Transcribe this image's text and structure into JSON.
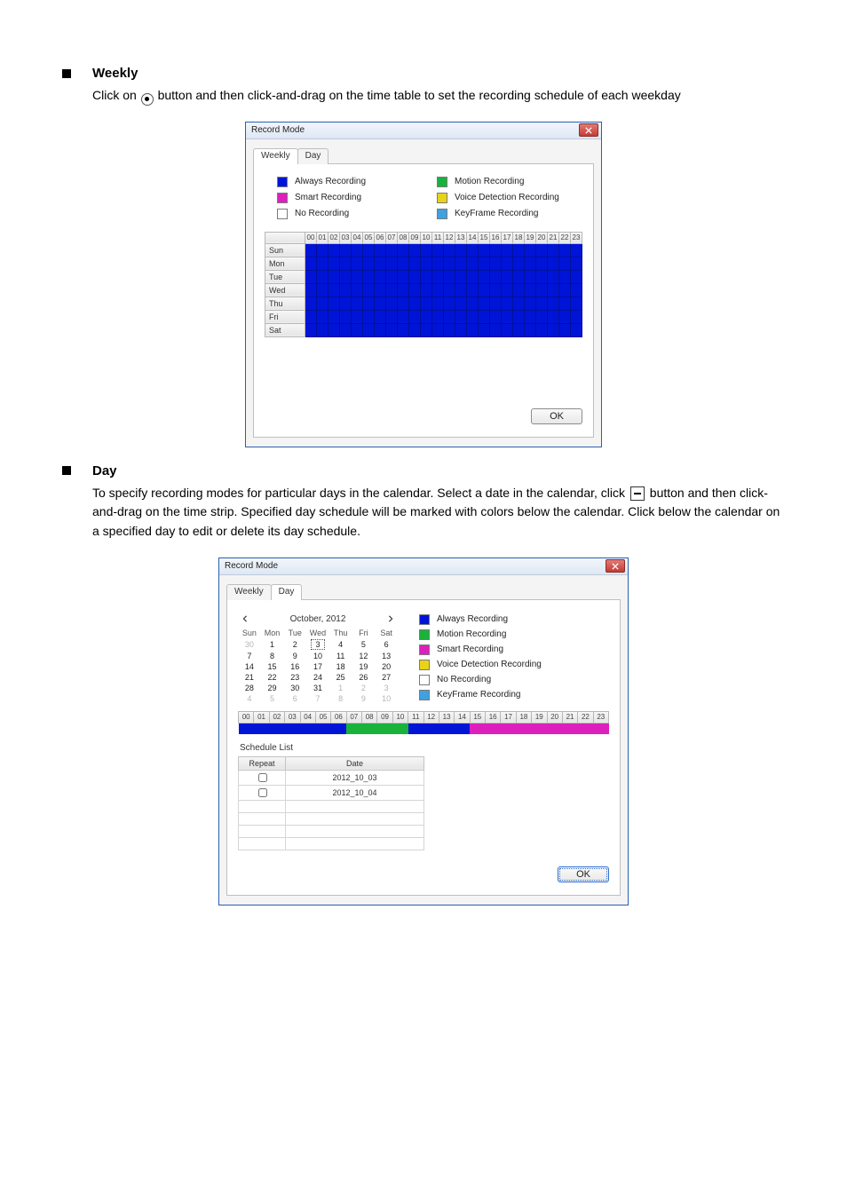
{
  "sections": {
    "weekly": {
      "title": "Weekly",
      "text": "Click on  button and then click-and-drag on the time table to set the recording schedule of each weekday"
    },
    "day": {
      "title": "Day",
      "text_a": "To specify recording modes for particular days in the calendar. Select a date in the calendar, click ",
      "text_b": " button and then click-and-drag on the time strip. Specified day schedule will be marked with colors below the calendar. Click below the calendar on a specified day to edit or delete its day schedule."
    }
  },
  "dialog_weekly": {
    "title": "Record Mode",
    "tabs": {
      "weekly": "Weekly",
      "day": "Day"
    },
    "legend": {
      "always": "Always Recording",
      "motion": "Motion Recording",
      "smart": "Smart Recording",
      "voice": "Voice Detection Recording",
      "none": "No Recording",
      "keyframe": "KeyFrame Recording"
    },
    "colors": {
      "always": "#0014d8",
      "motion": "#19b23b",
      "smart": "#dd1fbe",
      "voice": "#e8d317",
      "none": "#ffffff",
      "keyframe": "#3fa1e0"
    },
    "hours": [
      "00",
      "01",
      "02",
      "03",
      "04",
      "05",
      "06",
      "07",
      "08",
      "09",
      "10",
      "11",
      "12",
      "13",
      "14",
      "15",
      "16",
      "17",
      "18",
      "19",
      "20",
      "21",
      "22",
      "23"
    ],
    "days": [
      "Sun",
      "Mon",
      "Tue",
      "Wed",
      "Thu",
      "Fri",
      "Sat"
    ],
    "ok": "OK"
  },
  "dialog_day": {
    "title": "Record Mode",
    "tabs": {
      "weekly": "Weekly",
      "day": "Day"
    },
    "calendar": {
      "month_label": "October, 2012",
      "weekdays": [
        "Sun",
        "Mon",
        "Tue",
        "Wed",
        "Thu",
        "Fri",
        "Sat"
      ],
      "selected_day": 3,
      "rows": [
        [
          {
            "n": 30,
            "dim": true
          },
          {
            "n": 1
          },
          {
            "n": 2
          },
          {
            "n": 3
          },
          {
            "n": 4
          },
          {
            "n": 5
          },
          {
            "n": 6
          }
        ],
        [
          {
            "n": 7
          },
          {
            "n": 8
          },
          {
            "n": 9
          },
          {
            "n": 10
          },
          {
            "n": 11
          },
          {
            "n": 12
          },
          {
            "n": 13
          }
        ],
        [
          {
            "n": 14
          },
          {
            "n": 15
          },
          {
            "n": 16
          },
          {
            "n": 17
          },
          {
            "n": 18
          },
          {
            "n": 19
          },
          {
            "n": 20
          }
        ],
        [
          {
            "n": 21
          },
          {
            "n": 22
          },
          {
            "n": 23
          },
          {
            "n": 24
          },
          {
            "n": 25
          },
          {
            "n": 26
          },
          {
            "n": 27
          }
        ],
        [
          {
            "n": 28
          },
          {
            "n": 29
          },
          {
            "n": 30
          },
          {
            "n": 31
          },
          {
            "n": 1,
            "dim": true
          },
          {
            "n": 2,
            "dim": true
          },
          {
            "n": 3,
            "dim": true
          }
        ],
        [
          {
            "n": 4,
            "dim": true
          },
          {
            "n": 5,
            "dim": true
          },
          {
            "n": 6,
            "dim": true
          },
          {
            "n": 7,
            "dim": true
          },
          {
            "n": 8,
            "dim": true
          },
          {
            "n": 9,
            "dim": true
          },
          {
            "n": 10,
            "dim": true
          }
        ]
      ]
    },
    "hours": [
      "00",
      "01",
      "02",
      "03",
      "04",
      "05",
      "06",
      "07",
      "08",
      "09",
      "10",
      "11",
      "12",
      "13",
      "14",
      "15",
      "16",
      "17",
      "18",
      "19",
      "20",
      "21",
      "22",
      "23"
    ],
    "strip_colors": [
      "#0014d8",
      "#0014d8",
      "#0014d8",
      "#0014d8",
      "#0014d8",
      "#0014d8",
      "#0014d8",
      "#19b23b",
      "#19b23b",
      "#19b23b",
      "#19b23b",
      "#0014d8",
      "#0014d8",
      "#0014d8",
      "#0014d8",
      "#dd1fbe",
      "#dd1fbe",
      "#dd1fbe",
      "#dd1fbe",
      "#dd1fbe",
      "#dd1fbe",
      "#dd1fbe",
      "#dd1fbe",
      "#dd1fbe"
    ],
    "schedule_list_label": "Schedule List",
    "sched_headers": {
      "repeat": "Repeat",
      "date": "Date"
    },
    "sched_rows": [
      {
        "date": "2012_10_03"
      },
      {
        "date": "2012_10_04"
      }
    ],
    "ok": "OK"
  }
}
